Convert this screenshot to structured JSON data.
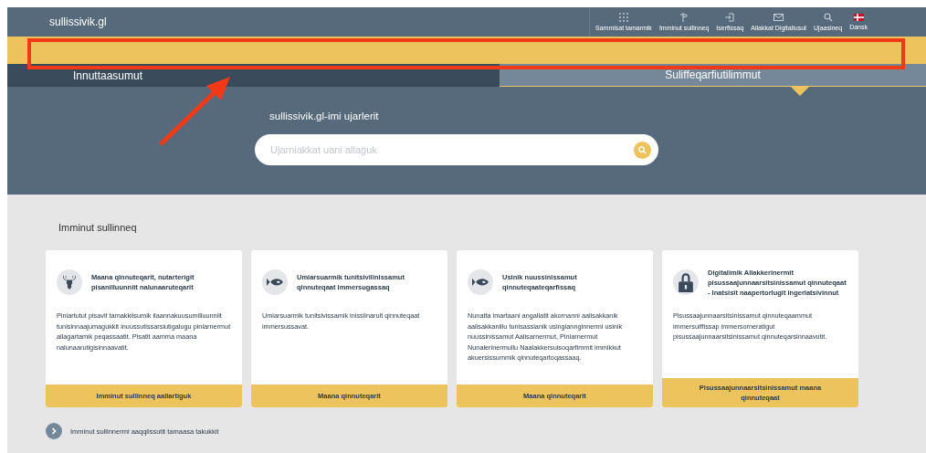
{
  "header": {
    "logo": "sullissivik.gl",
    "nav": [
      {
        "label": "Sammisat tamarmik"
      },
      {
        "label": "Imminut sullinneq"
      },
      {
        "label": "Iserfissaq"
      },
      {
        "label": "Allakkat Digitaliusut"
      },
      {
        "label": "Ujaasineq"
      },
      {
        "label": "Dansk"
      }
    ]
  },
  "tabs": [
    {
      "label": "Innuttaasumut",
      "selected": false
    },
    {
      "label": "Suliffeqarfiutilimmut",
      "selected": true
    }
  ],
  "hero": {
    "title": "sullissivik.gl-imi ujarlerit",
    "search": {
      "placeholder": "Ujarniakkat uani allaguk"
    }
  },
  "section": {
    "title": "Imminut sullinneq",
    "cards": [
      {
        "title": "Maana qinnuteqarit, nutarterigit pisanilluunniit nalunaaruteqarit",
        "text": "Piniartutut pisavit tamakkiisumik ilaannakuusumilluunniit tunisinnaajumagukkit inuussutissarsiutigalugu piniarnermut allagartamik peqassaatit. Pisatit aamma maana nalunaarutigisinnaavatit.",
        "button": "Imminut sullinneq aallartiguk"
      },
      {
        "title": "Umiarsuarmik tunitsivilinissamut qinnuteqaat immersugassaq",
        "text": "Umiarsuarmik tunitsivissamik inissiinarult qinnuteqaat immersussavat.",
        "button": "Maana qinnuteqarit"
      },
      {
        "title": "Usinik nuussinissamut qinnuteqaateqarfissaq",
        "text": "Nunatta imartaani angallatit akornanni aalisakkanik aalisakkanillu tunisassianik usingiannginnermi usinik nuussinissamut Aalisarnermut, Piniarnermut Nunalerinermullu Naalakkersuisoqarfimmit immikkut akuersissummik qinnuteqartoqassaaq.",
        "button": "Maana qinnuteqarit"
      },
      {
        "title": "Digitalimik Allakkerinermit pisussaajunnaarsitsinissamut qinnuteqaat - Inatsisit naapertorlugit ingerlatsivinnut",
        "text": "Pisussaajunnaarsitsinissamut qinnuteqaammut immersuiffissap immersorneratigut pisussaajunnaarsitsinissamut qinnuteqarsinnaavutit.",
        "button": "Pisussaajunnaarsitsinissamut maana qinnuteqaat"
      }
    ],
    "more_link": "Imminut sullinnermi aaqqiissutit tamaasa takukkit"
  }
}
